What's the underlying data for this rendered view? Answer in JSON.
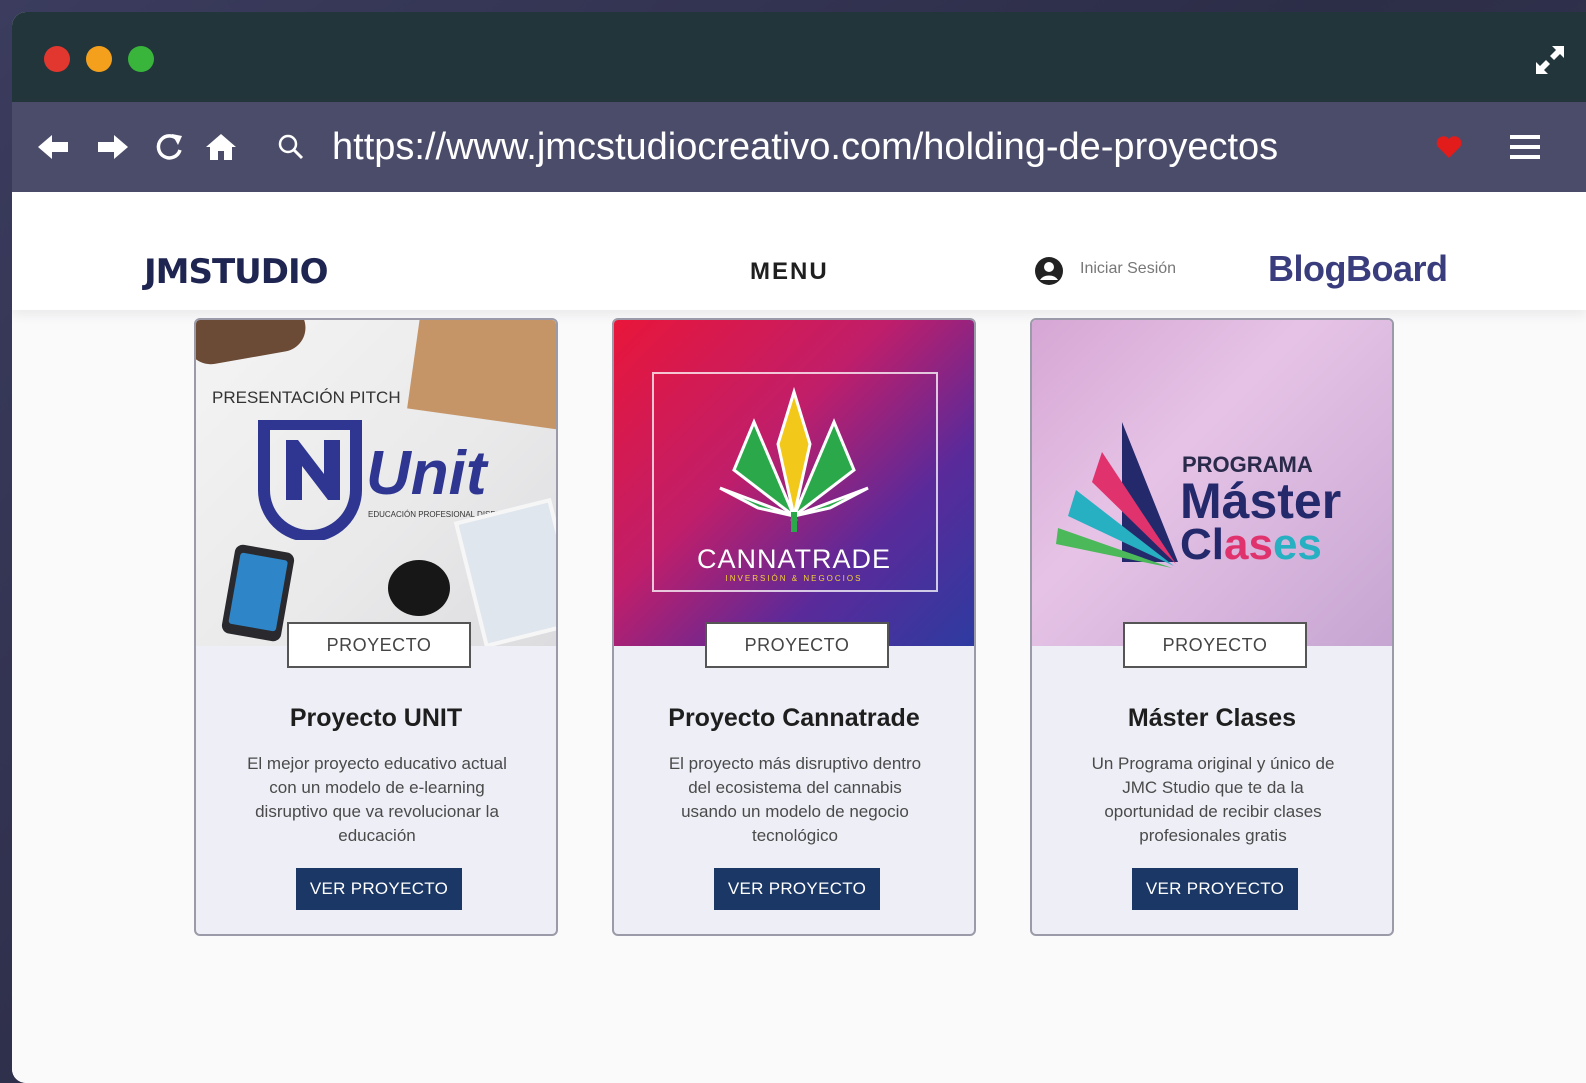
{
  "browser": {
    "url": "https://www.jmcstudiocreativo.com/holding-de-proyectos",
    "icons": [
      "back-arrow-icon",
      "forward-arrow-icon",
      "reload-icon",
      "home-icon",
      "search-icon",
      "heart-icon",
      "hamburger-menu-icon",
      "expand-icon"
    ],
    "colors": {
      "titlebar": "#22353a",
      "toolbar": "#4b4c6a",
      "heart": "#e21b1b"
    }
  },
  "site": {
    "logo": "JMSTUDIO",
    "menu_label": "MENU",
    "login_label": "Iniciar Sesión",
    "blog_label": "BlogBoard"
  },
  "cards": [
    {
      "image": {
        "pitch_label": "PRESENTACIÓN PITCH",
        "brand": "Unit",
        "brand_sub": "EDUCACIÓN PROFESIONAL DISRUPTIVA"
      },
      "tag": "PROYECTO",
      "title": "Proyecto UNIT",
      "description": "El mejor proyecto educativo actual con un modelo de e-learning disruptivo que va revolucionar la educación",
      "button": "VER PROYECTO"
    },
    {
      "image": {
        "brand": "CANNATRADE",
        "brand_sub": "INVERSIÓN & NEGOCIOS"
      },
      "tag": "PROYECTO",
      "title": "Proyecto Cannatrade",
      "description": "El proyecto más disruptivo dentro del ecosistema del cannabis usando un modelo de negocio tecnológico",
      "button": "VER PROYECTO"
    },
    {
      "image": {
        "line1": "PROGRAMA",
        "line2": "Máster",
        "line3a": "Cl",
        "line3b": "as",
        "line3c": "es"
      },
      "tag": "PROYECTO",
      "title": "Máster Clases",
      "description": "Un Programa original y único de JMC Studio que te da la oportunidad de recibir clases profesionales gratis",
      "button": "VER PROYECTO"
    }
  ]
}
